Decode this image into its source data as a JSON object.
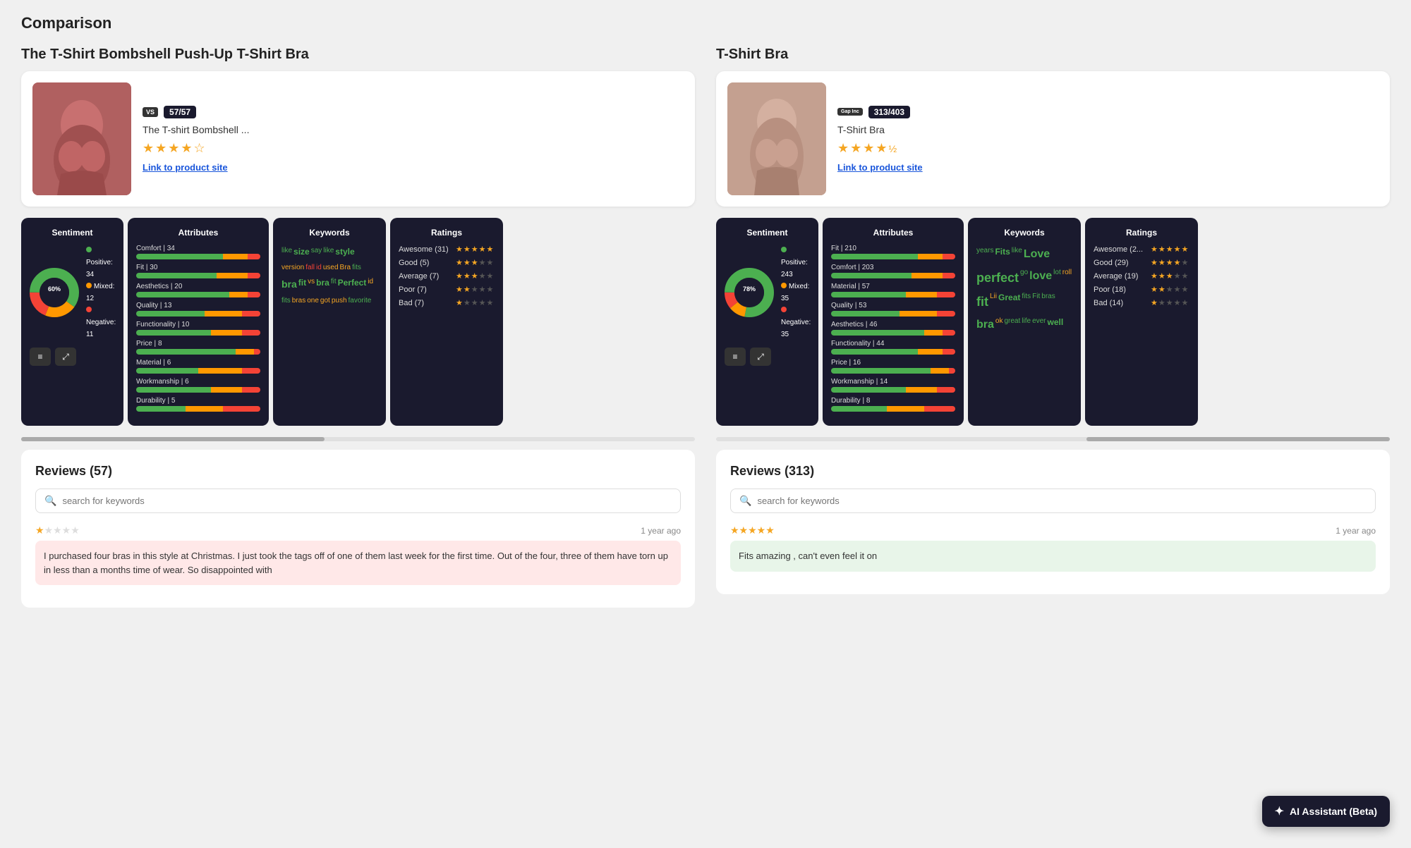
{
  "page": {
    "title": "Comparison"
  },
  "left_product": {
    "title": "The T-Shirt Bombshell Push-Up T-Shirt Bra",
    "logo": "VS",
    "count_badge": "57/57",
    "name": "The T-shirt Bombshell ...",
    "rating": 4.0,
    "link_text": "Link to product site",
    "sentiment": {
      "title": "Sentiment",
      "positive_pct": 60,
      "mixed_pct": 21,
      "negative_pct": 19,
      "positive_count": 34,
      "mixed_count": 12,
      "negative_count": 11
    },
    "attributes": {
      "title": "Attributes",
      "items": [
        {
          "label": "Comfort | 34",
          "green": 70,
          "orange": 20,
          "red": 10
        },
        {
          "label": "Fit | 30",
          "green": 65,
          "orange": 25,
          "red": 10
        },
        {
          "label": "Aesthetics | 20",
          "green": 75,
          "orange": 15,
          "red": 10
        },
        {
          "label": "Quality | 13",
          "green": 55,
          "orange": 30,
          "red": 15
        },
        {
          "label": "Functionality | 10",
          "green": 60,
          "orange": 25,
          "red": 15
        },
        {
          "label": "Price | 8",
          "green": 80,
          "orange": 15,
          "red": 5
        },
        {
          "label": "Material | 6",
          "green": 50,
          "orange": 35,
          "red": 15
        },
        {
          "label": "Workmanship | 6",
          "green": 60,
          "orange": 25,
          "red": 15
        },
        {
          "label": "Durability | 5",
          "green": 40,
          "orange": 30,
          "red": 30
        }
      ]
    },
    "keywords": {
      "title": "Keywords",
      "words": [
        {
          "text": "like",
          "color": "green",
          "size": "sm"
        },
        {
          "text": "size",
          "color": "green",
          "size": "md"
        },
        {
          "text": "say",
          "color": "green",
          "size": "sm"
        },
        {
          "text": "like",
          "color": "green",
          "size": "sm"
        },
        {
          "text": "style",
          "color": "green",
          "size": "md"
        },
        {
          "text": "version",
          "color": "yellow",
          "size": "sm"
        },
        {
          "text": "fall",
          "color": "red",
          "size": "sm"
        },
        {
          "text": "id",
          "color": "red",
          "size": "sm"
        },
        {
          "text": "used",
          "color": "yellow",
          "size": "sm"
        },
        {
          "text": "Bra",
          "color": "yellow",
          "size": "sm"
        },
        {
          "text": "fits",
          "color": "green",
          "size": "sm"
        },
        {
          "text": "bra",
          "color": "green",
          "size": "lg"
        },
        {
          "text": "fit",
          "color": "green",
          "size": "md"
        },
        {
          "text": "vs",
          "color": "yellow",
          "size": "sm"
        },
        {
          "text": "bra",
          "color": "green",
          "size": "md"
        },
        {
          "text": "fit",
          "color": "green",
          "size": "sm"
        },
        {
          "text": "Perfect",
          "color": "green",
          "size": "md"
        },
        {
          "text": "id",
          "color": "yellow",
          "size": "sm"
        },
        {
          "text": "fits",
          "color": "green",
          "size": "sm"
        },
        {
          "text": "bras",
          "color": "yellow",
          "size": "sm"
        },
        {
          "text": "one",
          "color": "yellow",
          "size": "sm"
        },
        {
          "text": "got",
          "color": "yellow",
          "size": "sm"
        },
        {
          "text": "push",
          "color": "yellow",
          "size": "sm"
        },
        {
          "text": "favorite",
          "color": "green",
          "size": "sm"
        }
      ]
    },
    "ratings": {
      "title": "Ratings",
      "items": [
        {
          "label": "Awesome (31)",
          "stars": 5
        },
        {
          "label": "Good (5)",
          "stars": 3
        },
        {
          "label": "Average (7)",
          "stars": 3
        },
        {
          "label": "Poor (7)",
          "stars": 2
        },
        {
          "label": "Bad (7)",
          "stars": 1
        }
      ]
    },
    "reviews": {
      "title": "Reviews (57)",
      "search_placeholder": "search for keywords",
      "items": [
        {
          "stars": 1,
          "time": "1 year ago",
          "text": "I purchased four bras in this style at Christmas. I just took the tags off of one of them last week for the first time. Out of the four, three of them have torn up in less than a months time of wear. So disappointed with",
          "sentiment": "negative"
        }
      ]
    }
  },
  "right_product": {
    "title": "T-Shirt Bra",
    "logo": "Gap Inc",
    "count_badge": "313/403",
    "name": "T-Shirt Bra",
    "rating": 4.5,
    "link_text": "Link to product site",
    "sentiment": {
      "title": "Sentiment",
      "positive_pct": 78,
      "mixed_pct": 11,
      "negative_pct": 11,
      "positive_count": 243,
      "mixed_count": 35,
      "negative_count": 35
    },
    "attributes": {
      "title": "Attributes",
      "items": [
        {
          "label": "Fit | 210",
          "green": 70,
          "orange": 20,
          "red": 10
        },
        {
          "label": "Comfort | 203",
          "green": 65,
          "orange": 25,
          "red": 10
        },
        {
          "label": "Material | 57",
          "green": 60,
          "orange": 25,
          "red": 15
        },
        {
          "label": "Quality | 53",
          "green": 55,
          "orange": 30,
          "red": 15
        },
        {
          "label": "Aesthetics | 46",
          "green": 75,
          "orange": 15,
          "red": 10
        },
        {
          "label": "Functionality | 44",
          "green": 70,
          "orange": 20,
          "red": 10
        },
        {
          "label": "Price | 16",
          "green": 80,
          "orange": 15,
          "red": 5
        },
        {
          "label": "Workmanship | 14",
          "green": 60,
          "orange": 25,
          "red": 15
        },
        {
          "label": "Durability | 8",
          "green": 45,
          "orange": 30,
          "red": 25
        }
      ]
    },
    "keywords": {
      "title": "Keywords",
      "words": [
        {
          "text": "years",
          "color": "green",
          "size": "sm"
        },
        {
          "text": "Fits",
          "color": "green",
          "size": "md"
        },
        {
          "text": "like",
          "color": "green",
          "size": "sm"
        },
        {
          "text": "Love",
          "color": "green",
          "size": "lg"
        },
        {
          "text": "perfect",
          "color": "green",
          "size": "lg"
        },
        {
          "text": "go",
          "color": "green",
          "size": "sm"
        },
        {
          "text": "love",
          "color": "green",
          "size": "lg"
        },
        {
          "text": "lot",
          "color": "green",
          "size": "sm"
        },
        {
          "text": "roll",
          "color": "yellow",
          "size": "sm"
        },
        {
          "text": "fit",
          "color": "green",
          "size": "lg"
        },
        {
          "text": "Lii",
          "color": "yellow",
          "size": "sm"
        },
        {
          "text": "Great",
          "color": "green",
          "size": "md"
        },
        {
          "text": "fits",
          "color": "green",
          "size": "sm"
        },
        {
          "text": "Fit",
          "color": "green",
          "size": "sm"
        },
        {
          "text": "bras",
          "color": "green",
          "size": "sm"
        },
        {
          "text": "bra",
          "color": "green",
          "size": "lg"
        },
        {
          "text": "ok",
          "color": "yellow",
          "size": "sm"
        },
        {
          "text": "great",
          "color": "green",
          "size": "sm"
        },
        {
          "text": "life",
          "color": "green",
          "size": "sm"
        },
        {
          "text": "ever",
          "color": "green",
          "size": "sm"
        },
        {
          "text": "well",
          "color": "green",
          "size": "md"
        }
      ]
    },
    "ratings": {
      "title": "Ratings",
      "items": [
        {
          "label": "Awesome (2",
          "stars": 5
        },
        {
          "label": "Good (29)",
          "stars": 4
        },
        {
          "label": "Average (19)",
          "stars": 3
        },
        {
          "label": "Poor (18)",
          "stars": 2
        },
        {
          "label": "Bad (14)",
          "stars": 1
        }
      ]
    },
    "reviews": {
      "title": "Reviews (313)",
      "search_placeholder": "search for keywords",
      "items": [
        {
          "stars": 5,
          "time": "1 year ago",
          "text": "Fits amazing , can't even feel it on",
          "sentiment": "positive"
        }
      ]
    }
  },
  "ai_assistant": {
    "label": "AI Assistant (Beta)"
  },
  "icons": {
    "search": "🔍",
    "filter": "≡",
    "expand": "⤢",
    "star_full": "★",
    "star_empty": "☆",
    "ai_spark": "✦"
  }
}
